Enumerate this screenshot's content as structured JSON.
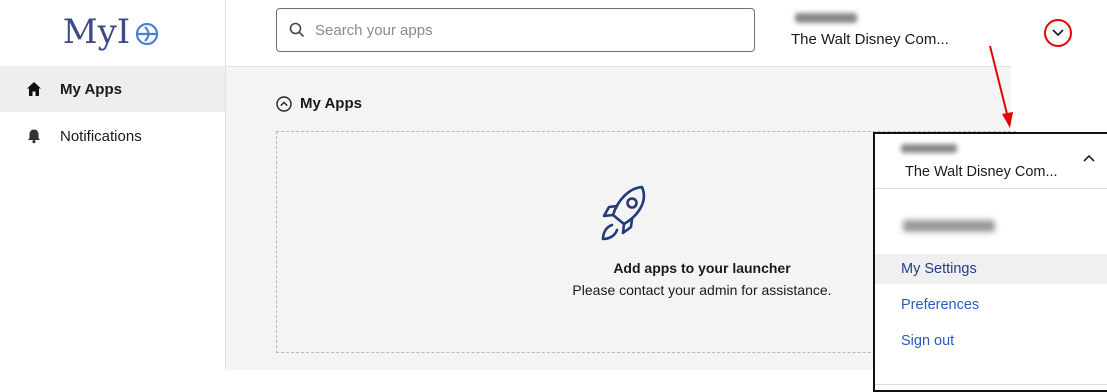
{
  "logo": {
    "text": "MyI"
  },
  "sidebar": {
    "items": [
      {
        "label": "My Apps",
        "icon": "home-icon",
        "active": true
      },
      {
        "label": "Notifications",
        "icon": "bell-icon",
        "active": false
      }
    ]
  },
  "header": {
    "search_placeholder": "Search your apps",
    "user_org": "The Walt Disney Com..."
  },
  "main": {
    "section_title": "My Apps",
    "empty_title": "Add apps to your launcher",
    "empty_subtitle": "Please contact your admin for assistance."
  },
  "dropdown": {
    "org": "The Walt Disney Com...",
    "items": [
      {
        "label": "My Settings"
      },
      {
        "label": "Preferences"
      },
      {
        "label": "Sign out"
      }
    ]
  },
  "colors": {
    "brand": "#3b4a8a",
    "link": "#2a5bbd",
    "annotation": "#e60000",
    "rocket": "#233a7a"
  }
}
